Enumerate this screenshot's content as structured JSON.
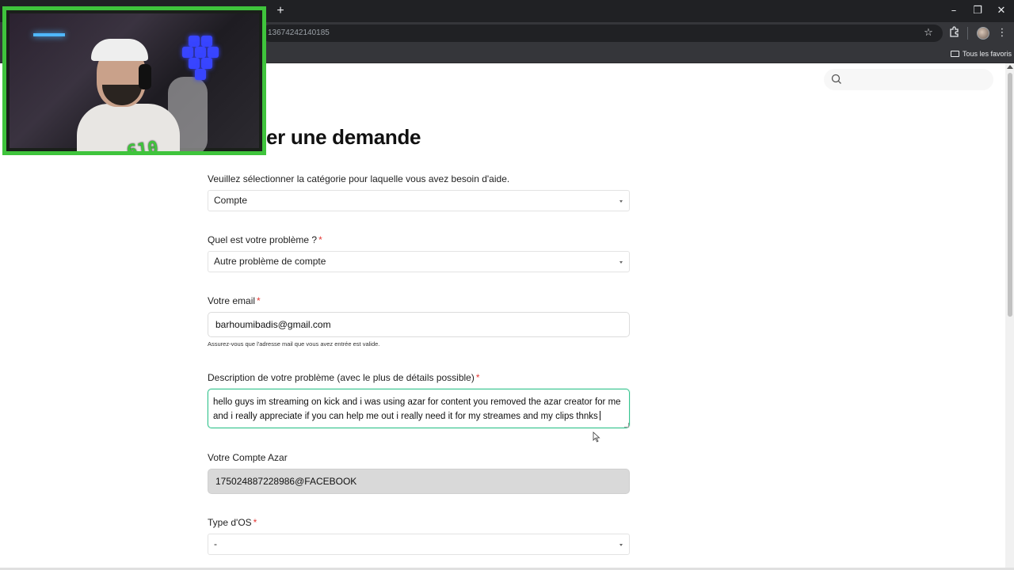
{
  "browser": {
    "url_fragment": "13674242140185",
    "bookmarks_folder": "Tous les favoris",
    "new_tab_glyph": "+",
    "window_controls": [
      "–",
      "❐",
      "✕"
    ]
  },
  "page": {
    "title": "er une demande"
  },
  "form": {
    "category_prompt": "Veuillez sélectionner la catégorie pour laquelle vous avez besoin d'aide.",
    "category_value": "Compte",
    "problem_label": "Quel est votre problème ?",
    "problem_value": "Autre problème de compte",
    "email_label": "Votre email",
    "email_value": "barhoumibadis@gmail.com",
    "email_hint": "Assurez-vous que l'adresse mail que vous avez entrée est valide.",
    "description_label": "Description de votre problème (avec le plus de détails possible)",
    "description_value": "hello guys im streaming on kick and i was using azar for content you removed the azar creator for me and i really appreciate if you can help me out i really need it for my streames and my clips thnks",
    "account_label": "Votre Compte Azar",
    "account_value": "175024887228986@FACEBOOK",
    "os_label": "Type d'OS",
    "os_value": "-",
    "required_mark": "*"
  },
  "colors": {
    "accent_focus": "#35c48f",
    "required": "#e53935",
    "webcam_border": "#3fc43c"
  },
  "webcam": {
    "logo_text": "610"
  }
}
